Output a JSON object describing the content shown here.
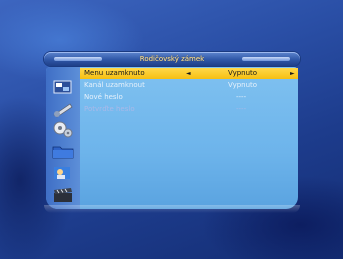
{
  "menu": {
    "title": "Rodičovský zámek"
  },
  "rows": [
    {
      "label": "Menu uzamknuto",
      "value": "Vypnuto",
      "arrow_left": "◄",
      "arrow_right": "►",
      "selected": true
    },
    {
      "label": "Kanál uzamknout",
      "value": "Vypnuto"
    },
    {
      "label": "Nové heslo",
      "value": "----"
    },
    {
      "label": "Potvrďte heslo",
      "value": "----"
    }
  ],
  "sidebar": {
    "icons": [
      "installation-icon",
      "satellite-dish-icon",
      "settings-gears-icon",
      "folder-icon",
      "user-preferences-icon",
      "clapperboard-icon"
    ]
  },
  "colors": {
    "background": "#1d3c8c",
    "panel": "#6db4eb",
    "highlight": "#f6bf12",
    "title_text": "#ffe9a2"
  }
}
